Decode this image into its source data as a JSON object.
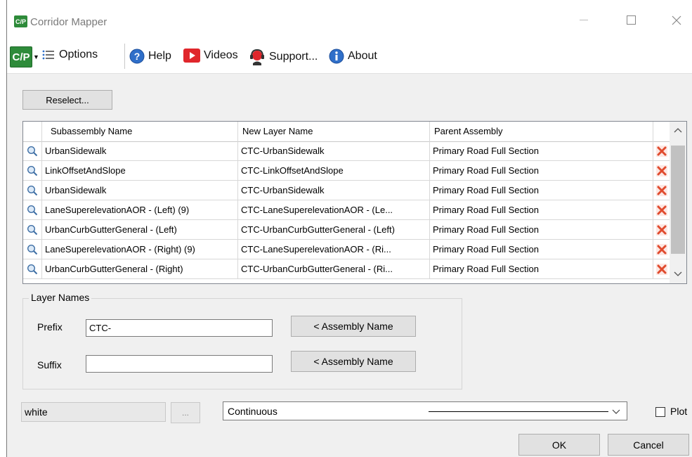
{
  "window": {
    "title": "Corridor Mapper",
    "logo_text": "C/P"
  },
  "toolbar": {
    "logo_text": "C/P",
    "options_label": "Options",
    "help_label": "Help",
    "videos_label": "Videos",
    "support_label": "Support...",
    "about_label": "About"
  },
  "reselect_label": "Reselect...",
  "table": {
    "columns": [
      "Subassembly Name",
      "New Layer Name",
      "Parent Assembly"
    ],
    "rows": [
      {
        "subassembly": "UrbanSidewalk",
        "layer": "CTC-UrbanSidewalk",
        "parent": "Primary Road Full Section"
      },
      {
        "subassembly": "LinkOffsetAndSlope",
        "layer": "CTC-LinkOffsetAndSlope",
        "parent": "Primary Road Full Section"
      },
      {
        "subassembly": "UrbanSidewalk",
        "layer": "CTC-UrbanSidewalk",
        "parent": "Primary Road Full Section"
      },
      {
        "subassembly": "LaneSuperelevationAOR - (Left) (9)",
        "layer": "CTC-LaneSuperelevationAOR - (Le...",
        "parent": "Primary Road Full Section"
      },
      {
        "subassembly": "UrbanCurbGutterGeneral - (Left)",
        "layer": "CTC-UrbanCurbGutterGeneral - (Left)",
        "parent": "Primary Road Full Section"
      },
      {
        "subassembly": "LaneSuperelevationAOR - (Right) (9)",
        "layer": "CTC-LaneSuperelevationAOR - (Ri...",
        "parent": "Primary Road Full Section"
      },
      {
        "subassembly": "UrbanCurbGutterGeneral - (Right)",
        "layer": "CTC-UrbanCurbGutterGeneral - (Ri...",
        "parent": "Primary Road Full Section"
      }
    ]
  },
  "layer_names": {
    "group_title": "Layer Names",
    "prefix_label": "Prefix",
    "prefix_value": "CTC-",
    "suffix_label": "Suffix",
    "suffix_value": "",
    "assembly_name_button": "< Assembly Name"
  },
  "color_value": "white",
  "color_button_label": "...",
  "linetype_value": "Continuous",
  "plot_label": "Plot",
  "plot_checked": false,
  "ok_label": "OK",
  "cancel_label": "Cancel",
  "colors": {
    "logo_green": "#2e8b3a",
    "delete_red": "#e04b2e",
    "help_blue": "#2f6fc9",
    "videos_red": "#e0262b"
  }
}
